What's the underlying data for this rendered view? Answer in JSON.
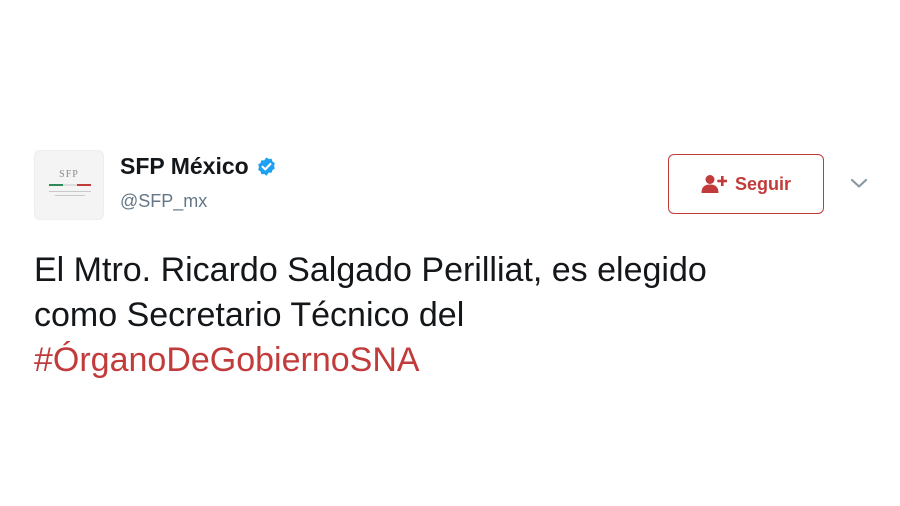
{
  "author": {
    "display_name": "SFP México",
    "handle": "@SFP_mx",
    "avatar_label": "SFP",
    "verified_icon": "verified-badge-icon"
  },
  "follow_button": {
    "label": "Seguir",
    "icon": "add-user-icon"
  },
  "menu": {
    "icon": "chevron-down-icon"
  },
  "tweet": {
    "line1": "El Mtro. Ricardo Salgado Perilliat, es elegido",
    "line2": "como Secretario Técnico del",
    "hashtag": "#ÓrganoDeGobiernoSNA"
  },
  "colors": {
    "accent": "#c23b3b",
    "verified": "#1da1f2",
    "handle": "#657786",
    "text": "#14171a"
  }
}
